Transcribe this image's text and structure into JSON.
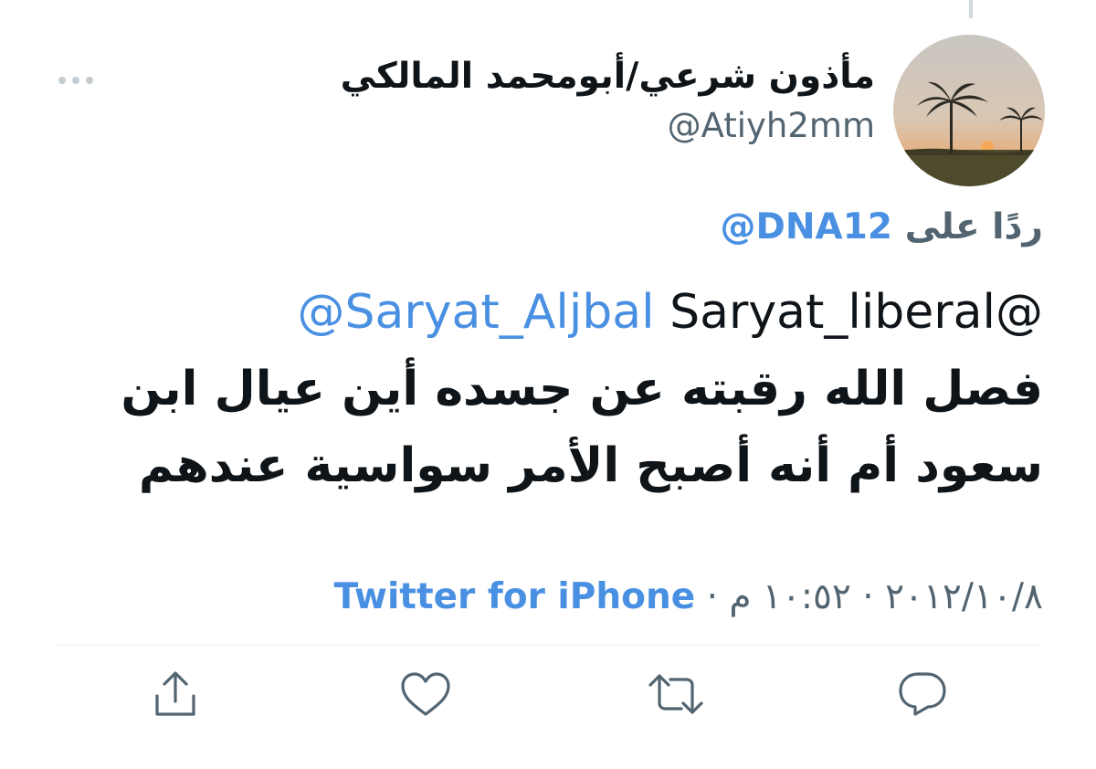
{
  "tweet": {
    "display_name": "مأذون شرعي/أبومحمد المالكي",
    "handle": "@Atiyh2mm",
    "reply_prefix": "ردًا على",
    "reply_to": "@DNA12",
    "body": {
      "mention_link": "@Saryat_Aljbal",
      "mention_plain": "Saryat_liberal@",
      "line2": "فصل الله رقبته عن جسده أين عيال ابن",
      "line3": "سعود أم أنه أصبح الأمر سواسية عندهم"
    },
    "date": "٢٠١٢/١٠/٨",
    "separator": "·",
    "time": "١٠:٥٢ م",
    "source": "Twitter for iPhone"
  },
  "icons": {
    "more": "more-horizontal-icon",
    "reply": "reply-bubble-icon",
    "retweet": "retweet-icon",
    "like": "heart-icon",
    "share": "share-upload-icon"
  },
  "colors": {
    "text_primary": "#0f1419",
    "text_secondary": "#536471",
    "link": "#4a90e2",
    "icon": "#536471"
  }
}
